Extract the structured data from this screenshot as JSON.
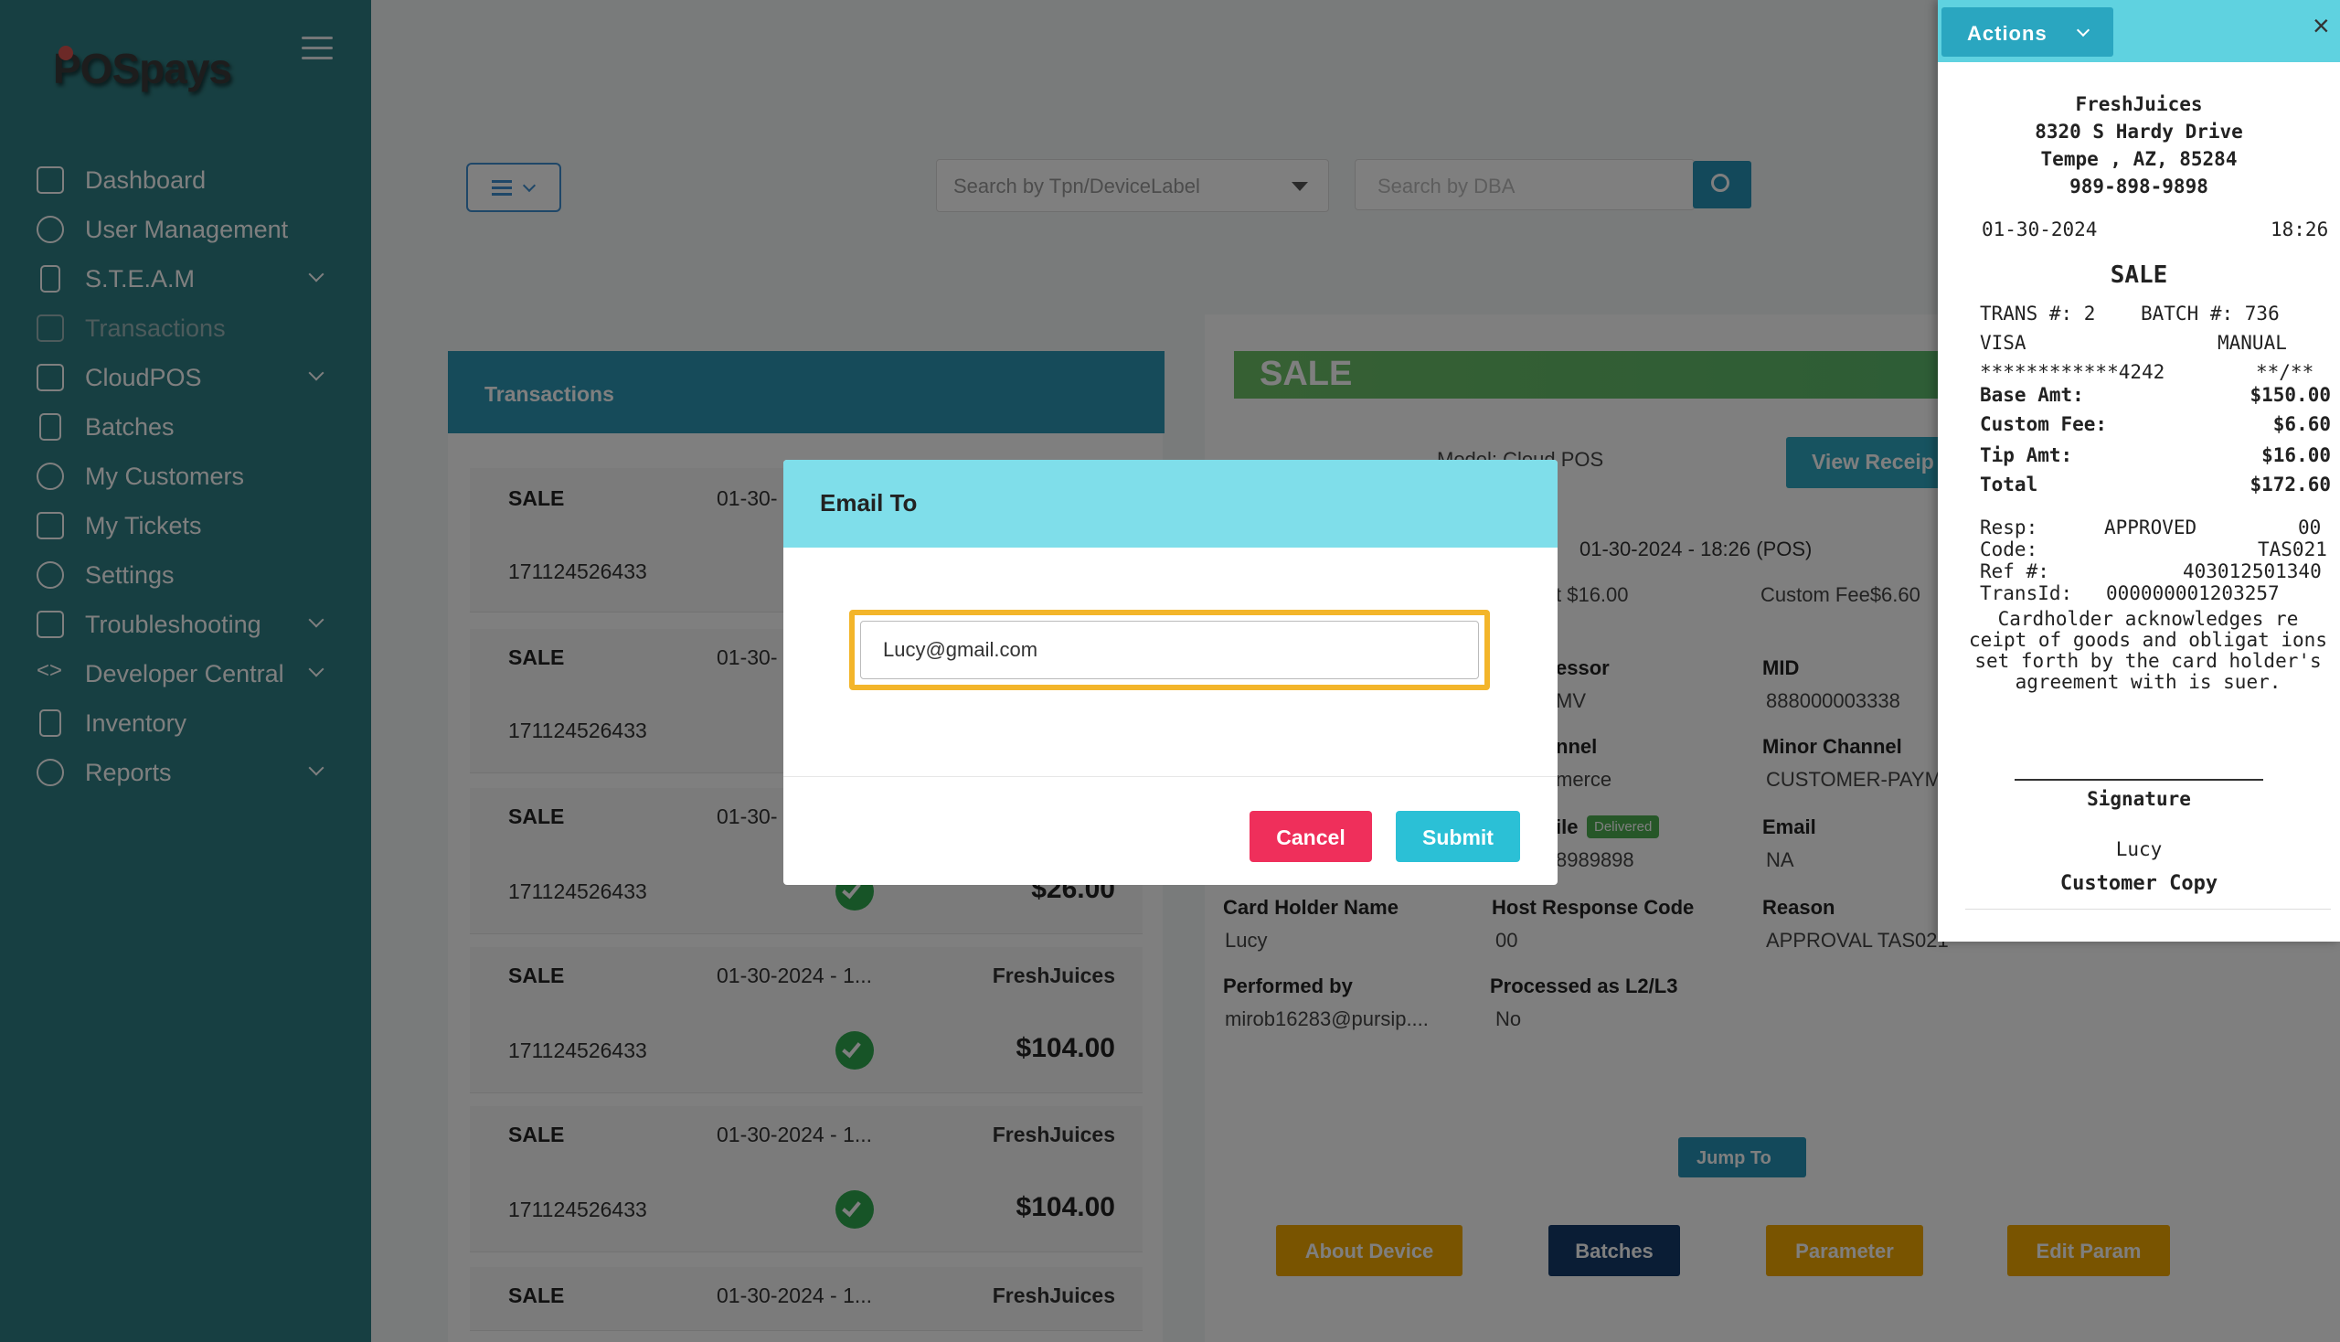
{
  "sidebar": {
    "logo": "POSpays",
    "items": [
      {
        "label": "Dashboard",
        "icon": "home-icon",
        "expandable": false
      },
      {
        "label": "User Management",
        "icon": "users-icon",
        "expandable": false
      },
      {
        "label": "S.T.E.A.M",
        "icon": "device-icon",
        "expandable": true
      },
      {
        "label": "Transactions",
        "icon": "layers-icon",
        "expandable": false,
        "active": true
      },
      {
        "label": "CloudPOS",
        "icon": "card-icon",
        "expandable": true
      },
      {
        "label": "Batches",
        "icon": "file-icon",
        "expandable": false
      },
      {
        "label": "My Customers",
        "icon": "user-icon",
        "expandable": false
      },
      {
        "label": "My Tickets",
        "icon": "inbox-icon",
        "expandable": false
      },
      {
        "label": "Settings",
        "icon": "gear-icon",
        "expandable": false
      },
      {
        "label": "Troubleshooting",
        "icon": "drive-icon",
        "expandable": true
      },
      {
        "label": "Developer Central",
        "icon": "code-icon",
        "expandable": true
      },
      {
        "label": "Inventory",
        "icon": "doc-icon",
        "expandable": false
      },
      {
        "label": "Reports",
        "icon": "chat-icon",
        "expandable": true
      }
    ]
  },
  "filters": {
    "tpn_placeholder": "Search by Tpn/DeviceLabel",
    "dba_placeholder": "Search by DBA"
  },
  "transactions": {
    "header": "Transactions",
    "rows": [
      {
        "type": "SALE",
        "date": "01-30-",
        "merchant": "",
        "tpn": "171124526433",
        "amount": "",
        "status": ""
      },
      {
        "type": "SALE",
        "date": "01-30-",
        "merchant": "",
        "tpn": "171124526433",
        "amount": "",
        "status": ""
      },
      {
        "type": "SALE",
        "date": "01-30-",
        "merchant": "",
        "tpn": "171124526433",
        "amount": "$26.00",
        "status": "ok"
      },
      {
        "type": "SALE",
        "date": "01-30-2024 - 1...",
        "merchant": "FreshJuices",
        "tpn": "171124526433",
        "amount": "$104.00",
        "status": "ok"
      },
      {
        "type": "SALE",
        "date": "01-30-2024 - 1...",
        "merchant": "FreshJuices",
        "tpn": "171124526433",
        "amount": "$104.00",
        "status": "ok"
      },
      {
        "type": "SALE",
        "date": "01-30-2024 - 1...",
        "merchant": "FreshJuices",
        "tpn": "",
        "amount": "",
        "status": ""
      }
    ]
  },
  "detail": {
    "banner": "SALE",
    "tpn_model": "Model: Cloud POS",
    "view_receipt": "View Receip",
    "datetime": "01-30-2024 - 18:26 (POS)",
    "tip_partial": "t $16.00",
    "custom_fee": "Custom Fee$6.60",
    "fields": [
      {
        "label": "essor",
        "value": "MV"
      },
      {
        "label": "MID",
        "value": "888000003338"
      },
      {
        "label": "nnel",
        "value": "merce"
      },
      {
        "label": "Minor Channel",
        "value": "CUSTOMER-PAYM"
      },
      {
        "label": "ile",
        "value": "8989898",
        "badge": "Delivered"
      },
      {
        "label": "Email",
        "value": "NA"
      },
      {
        "label": "Card Holder Name",
        "value": "Lucy"
      },
      {
        "label": "Host Response Code",
        "value": "00"
      },
      {
        "label": "Reason",
        "value": "APPROVAL TAS021"
      },
      {
        "label": "Performed by",
        "value": "mirob16283@pursip...."
      },
      {
        "label": "Processed as L2/L3",
        "value": "No"
      }
    ],
    "jump_to": "Jump To",
    "buttons": [
      {
        "label": "About Device",
        "color": "#f2a900"
      },
      {
        "label": "Batches",
        "color": "#153a6b"
      },
      {
        "label": "Parameter",
        "color": "#f2a900"
      },
      {
        "label": "Edit Param",
        "color": "#f2a900"
      }
    ]
  },
  "modal": {
    "title": "Email To",
    "email_value": "Lucy@gmail.com",
    "cancel": "Cancel",
    "submit": "Submit"
  },
  "receipt": {
    "actions": "Actions",
    "merchant": "FreshJuices",
    "address1": "8320 S Hardy Drive",
    "address2": "Tempe , AZ, 85284",
    "phone": "989-898-9898",
    "date": "01-30-2024",
    "time": "18:26",
    "type": "SALE",
    "trans": "TRANS #: 2",
    "batch": "BATCH #: 736",
    "card": "VISA",
    "entry": "MANUAL",
    "masked": "************4242",
    "exp": "**/**",
    "lines": [
      {
        "label": "Base Amt:",
        "value": "$150.00"
      },
      {
        "label": "Custom Fee:",
        "value": "$6.60"
      },
      {
        "label": "Tip Amt:",
        "value": "$16.00"
      },
      {
        "label": "Total",
        "value": "$172.60"
      }
    ],
    "resp_label": "Resp:",
    "resp_value": "APPROVED",
    "resp_code": "00",
    "code_label": "Code:",
    "code_value": "TAS021",
    "ref_label": "Ref #:",
    "ref_value": "403012501340",
    "transid_label": "TransId:",
    "transid_value": "000000001203257",
    "ack": "Cardholder acknowledges re ceipt of goods and obligat ions set forth by the card holder's agreement with is suer.",
    "signature_label": "Signature",
    "signature_name": "Lucy",
    "copy": "Customer Copy"
  }
}
